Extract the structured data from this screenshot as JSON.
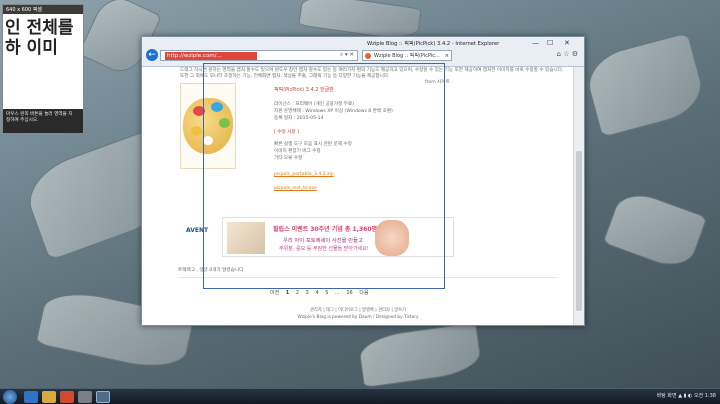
{
  "magnifier": {
    "title": "640 x 600 픽셀",
    "big_text_1": "인 전체를",
    "big_text_2": "하 이미",
    "caption_1": "마우스 왼쪽 버튼을 눌러 영역을 지",
    "caption_2": "정하여 주십시오."
  },
  "browser": {
    "window_title": "Wziple Blog :: 픽픽(PicPick) 3.4.2 - Internet Explorer",
    "address_text": "http://wziple.com/...",
    "address_icons": "⌕ ▾ ✕",
    "tab_label": "Wziple Blog :: 픽픽(PicPic...",
    "tab_close": "×",
    "toolbar_icons": "⌂ ☆ ⚙",
    "controls": {
      "minimize": "—",
      "maximize": "☐",
      "close": "✕"
    }
  },
  "page": {
    "intro_1": "드래그 하시면 원하는 영역을 캡처 할수도 있으며 윈도우 창만 캡처 할수도 있는 등 여러가지 편의 기능도 제공하고 있으며, 수정할 수 있는 기능 또한 제공하여 캡처한 이미지를 바로 수정할 수 있습니다.",
    "intro_2": "또한 그 외에도 모니터 조정하는 기능, 전체화면 캡처, 색상을 추출, 그래픽 기능 등 다양한 기능을 제공합니다.",
    "intro_src": "from 사이트",
    "release_title": "픽픽(PicPick) 3.4.2 한글판",
    "license": "라이선스 : 프리웨어 (개인 공용가정 무료)",
    "os": "지원 운영체제 : Windows XP 이상 (Windows 8 완벽 호환)",
    "date": "등록 일자 : 2015-05-14",
    "changes_header": "[ 수정 사항 ]",
    "change_1": "빠른 실행 도구 모음 표시 관련 문제 수정",
    "change_2": "이미지 편집기 버그 수정",
    "change_3": "기타 오류 수정",
    "download_1": "picpick_portable_3.4.2.zip",
    "download_2": "picpick_inst_kr.exe",
    "ad_brand": "AVENT",
    "ad_line_1": "필립스 이벤트 30주년 기념 총 1,360명에게 쏜다!",
    "ad_line_2": "우리 아이 포토에세이 사진을 만들고",
    "ad_line_3": "주위분, 응모 등 푸짐한 선물을 받아가세요!",
    "trackback": "트랙백 2 , 댓글 0개가 달렸습니다",
    "pager_prev": "이전",
    "pager_pages": [
      "1",
      "2",
      "3",
      "4",
      "5",
      "...",
      "16"
    ],
    "pager_next": "다음",
    "footer_1": "관리자 | 태그 | 미디어로그 | 방명록 | 관리자 | 글쓰기",
    "footer_2": "Wziple's Blog is powered by Daum / Designed by Tistory"
  },
  "tray": {
    "lang": "바탕 화면",
    "clock": "오전 1:38"
  },
  "colors": {
    "accent": "#3f65b0",
    "link": "#e07a19",
    "taskbar": "#1a242e"
  }
}
